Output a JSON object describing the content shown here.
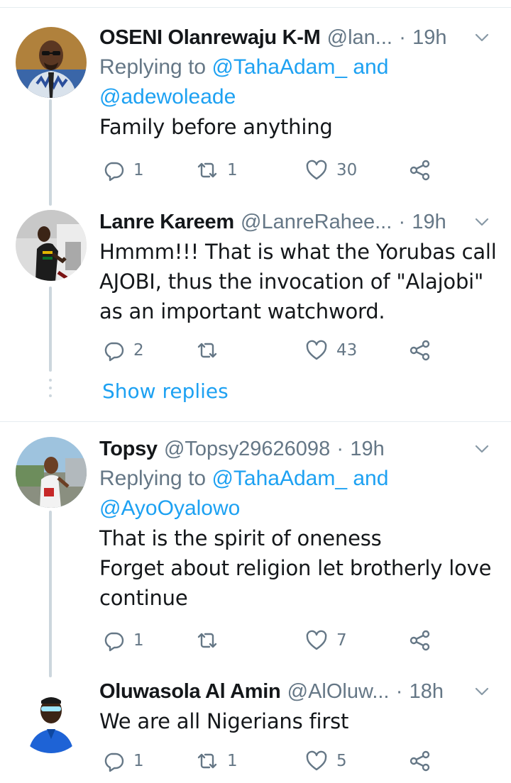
{
  "tweets": [
    {
      "name": "OSENI Olanrewaju K-M",
      "handle": "@lan...",
      "separator": "·",
      "time": "19h",
      "replying_prefix": "Replying to",
      "replying_mention1": "@TahaAdam_",
      "replying_and": "and",
      "replying_mention2": "@adewoleade",
      "body": [
        "Family before anything"
      ],
      "replies": "1",
      "retweets": "1",
      "likes": "30"
    },
    {
      "name": "Lanre Kareem",
      "handle": "@LanreRahee...",
      "separator": "·",
      "time": "19h",
      "body": [
        "Hmmm!!! That is what the Yorubas call",
        "AJOBI, thus the invocation of \"Alajobi\"",
        "as an important watchword."
      ],
      "replies": "2",
      "retweets": "",
      "likes": "43"
    },
    {
      "name": "Topsy",
      "handle": "@Topsy29626098",
      "separator": "·",
      "time": "19h",
      "replying_prefix": "Replying to",
      "replying_mention1": "@TahaAdam_",
      "replying_and": "and",
      "replying_mention2": "@AyoOyalowo",
      "body": [
        "That is the spirit of oneness",
        "Forget about religion let brotherly love",
        "continue"
      ],
      "replies": "1",
      "retweets": "",
      "likes": "7"
    },
    {
      "name": "Oluwasola Al Amin",
      "handle": "@AlOluw...",
      "separator": "·",
      "time": "18h",
      "body": [
        "We are all Nigerians first"
      ],
      "replies": "1",
      "retweets": "1",
      "likes": "5"
    }
  ],
  "show_replies_label": "Show replies",
  "icons": {
    "reply": "reply-icon",
    "retweet": "retweet-icon",
    "like": "heart-icon",
    "share": "share-icon",
    "more": "chevron-down-icon"
  },
  "colors": {
    "link": "#1da1f2",
    "secondary": "#657786",
    "text": "#14171a",
    "divider": "#e6ecf0"
  }
}
